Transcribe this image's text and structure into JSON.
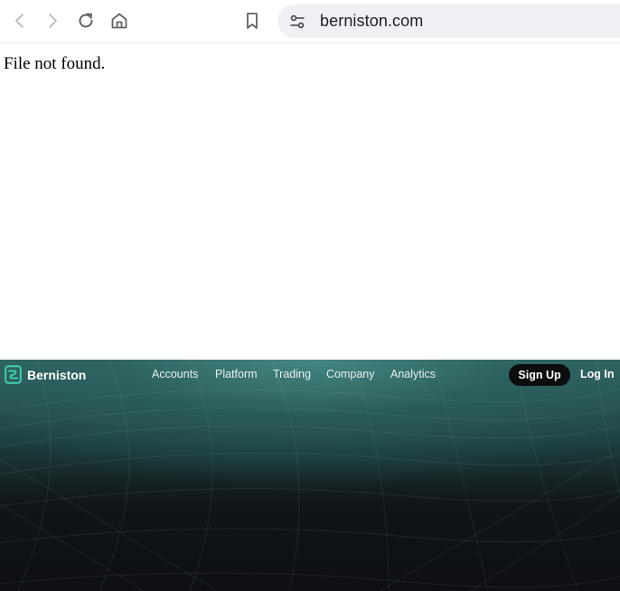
{
  "browser": {
    "url": "berniston.com",
    "icons": {
      "back": "chevron-left-icon",
      "forward": "chevron-right-icon",
      "reload": "reload-icon",
      "home": "home-icon",
      "bookmark": "bookmark-icon",
      "site_settings": "tune-icon"
    },
    "colors": {
      "toolbar": "#ffffff",
      "urlbar": "#eef0f3",
      "icon": "#5f6368"
    }
  },
  "page": {
    "error_message": "File not found."
  },
  "site": {
    "brand": "Berniston",
    "nav": [
      "Accounts",
      "Platform",
      "Trading",
      "Company",
      "Analytics"
    ],
    "sign_up": "Sign Up",
    "log_in": "Log In",
    "colors": {
      "accent": "#3fd0b0",
      "background_dark": "#0d0f12",
      "glow": "#2f6664"
    }
  }
}
